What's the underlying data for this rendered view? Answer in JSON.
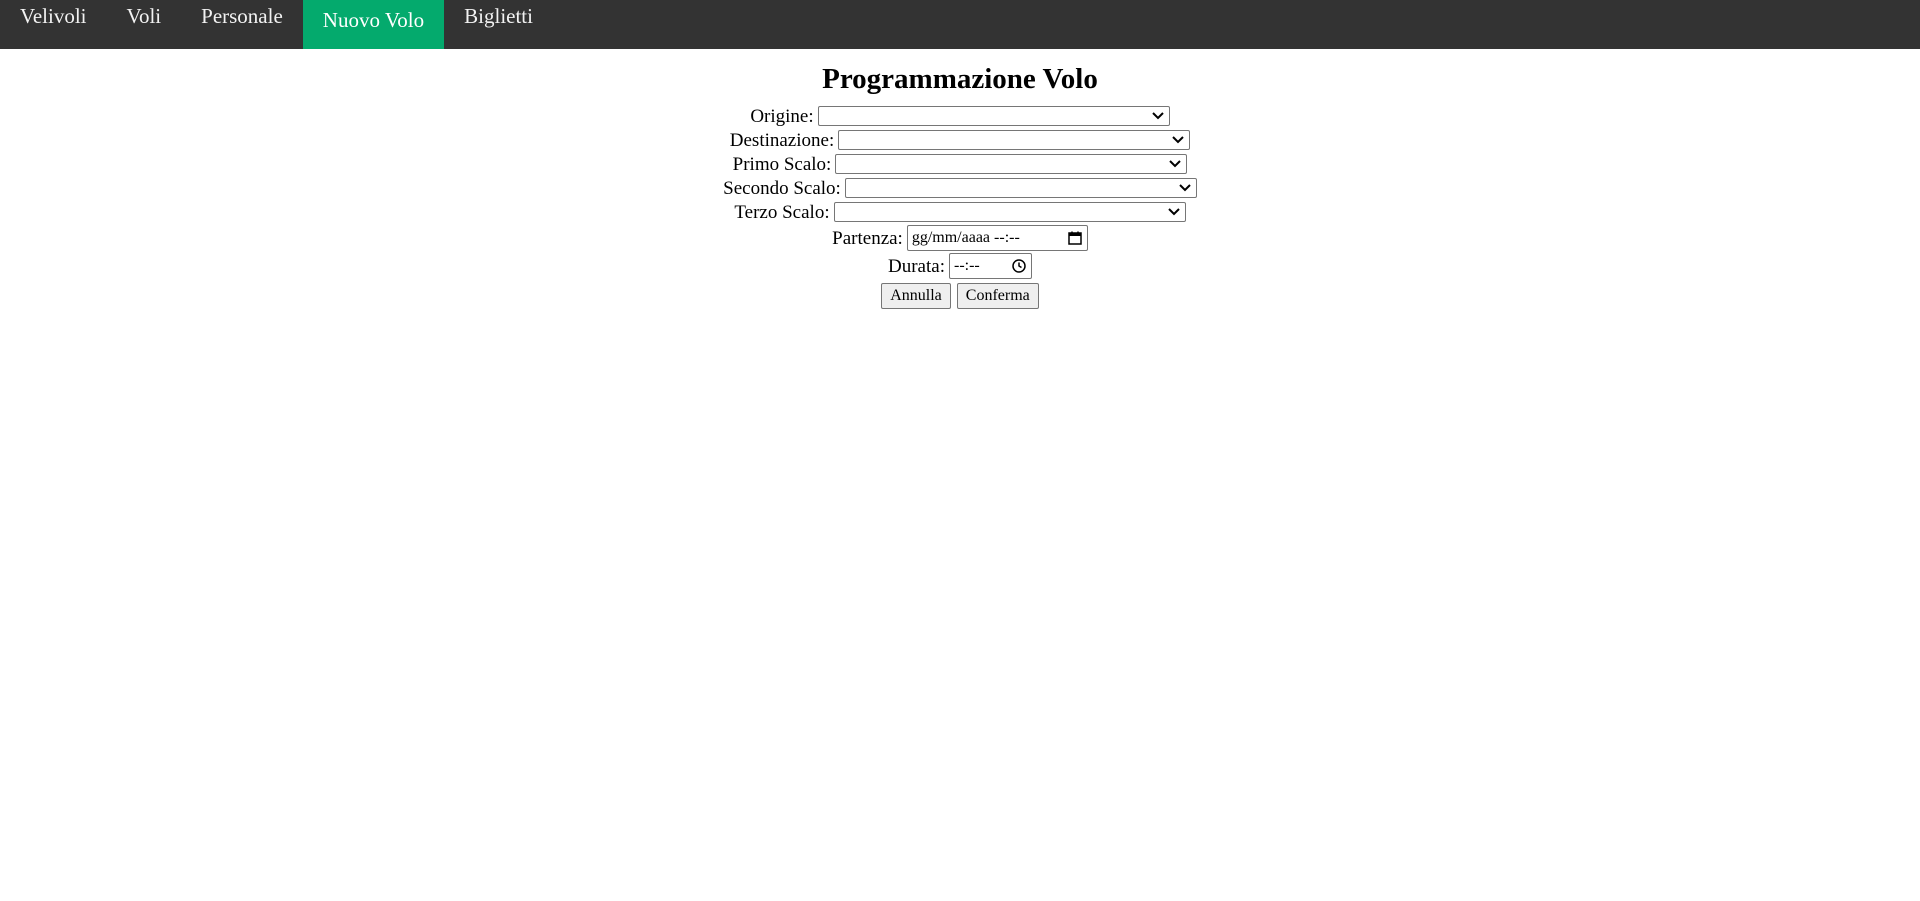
{
  "nav": {
    "items": [
      {
        "label": "Velivoli",
        "active": false
      },
      {
        "label": "Voli",
        "active": false
      },
      {
        "label": "Personale",
        "active": false
      },
      {
        "label": "Nuovo Volo",
        "active": true
      },
      {
        "label": "Biglietti",
        "active": false
      }
    ],
    "background_color": "#333333",
    "active_color": "#04aa6d"
  },
  "form": {
    "title": "Programmazione Volo",
    "fields": {
      "origine": {
        "label": "Origine:",
        "value": ""
      },
      "destinazione": {
        "label": "Destinazione:",
        "value": ""
      },
      "primo_scalo": {
        "label": "Primo Scalo:",
        "value": ""
      },
      "secondo_scalo": {
        "label": "Secondo Scalo:",
        "value": ""
      },
      "terzo_scalo": {
        "label": "Terzo Scalo:",
        "value": ""
      },
      "partenza": {
        "label": "Partenza:",
        "placeholder": "gg/mm/aaaa --:--"
      },
      "durata": {
        "label": "Durata:",
        "placeholder": "--:--"
      }
    },
    "buttons": {
      "cancel_label": "Annulla",
      "confirm_label": "Conferma"
    }
  },
  "icons": {
    "select_arrow": "chevron-down-icon",
    "date_picker": "calendar-icon",
    "time_picker": "clock-icon"
  }
}
